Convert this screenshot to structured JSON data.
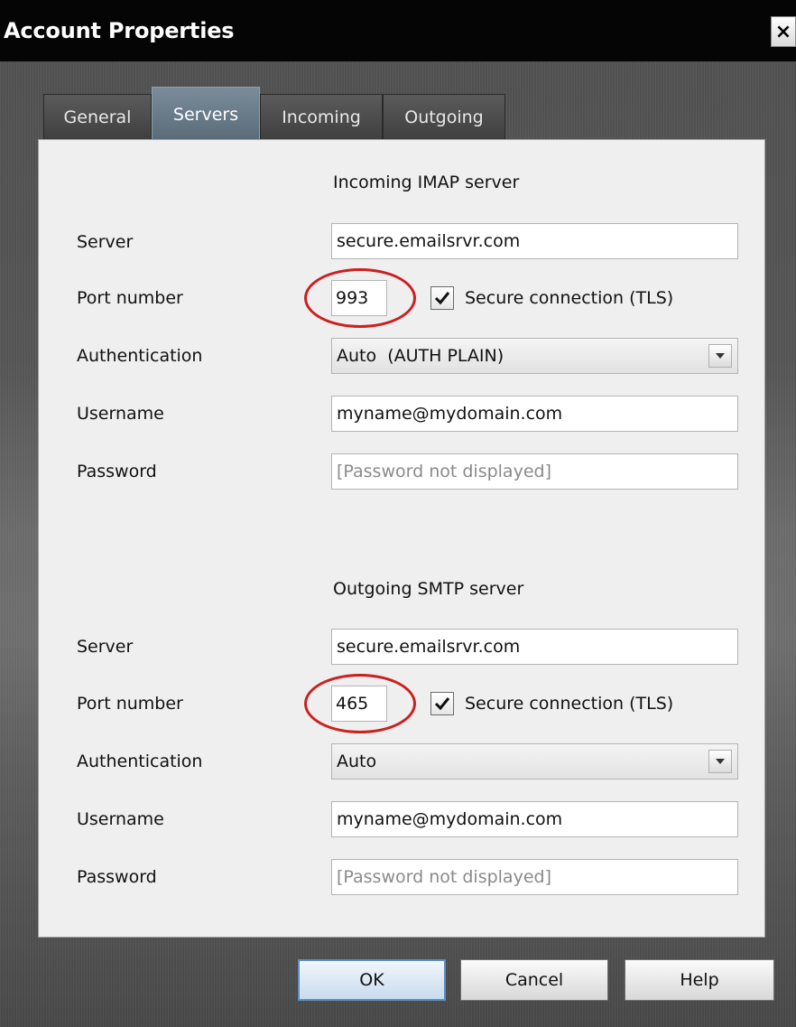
{
  "window": {
    "title": "Account Properties",
    "close_glyph": "×"
  },
  "tabs": [
    {
      "label": "General",
      "active": false
    },
    {
      "label": "Servers",
      "active": true
    },
    {
      "label": "Incoming",
      "active": false
    },
    {
      "label": "Outgoing",
      "active": false
    }
  ],
  "incoming": {
    "section_title": "Incoming IMAP server",
    "server_label": "Server",
    "server_value": "secure.emailsrvr.com",
    "port_label": "Port number",
    "port_value": "993",
    "secure_checked": true,
    "secure_label": "Secure connection (TLS)",
    "auth_label": "Authentication",
    "auth_value": "Auto  (AUTH PLAIN)",
    "username_label": "Username",
    "username_value": "myname@mydomain.com",
    "password_label": "Password",
    "password_placeholder": "[Password not displayed]"
  },
  "outgoing": {
    "section_title": "Outgoing SMTP server",
    "server_label": "Server",
    "server_value": "secure.emailsrvr.com",
    "port_label": "Port number",
    "port_value": "465",
    "secure_checked": true,
    "secure_label": "Secure connection (TLS)",
    "auth_label": "Authentication",
    "auth_value": "Auto",
    "username_label": "Username",
    "username_value": "myname@mydomain.com",
    "password_label": "Password",
    "password_placeholder": "[Password not displayed]"
  },
  "buttons": {
    "ok": "OK",
    "cancel": "Cancel",
    "help": "Help"
  },
  "colors": {
    "annotation_circle": "#cc1f1f",
    "active_tab": "#6a7b88",
    "default_button_border": "#5d8fc4"
  },
  "icons": {
    "close": "close-icon",
    "checkmark": "checkmark-icon",
    "dropdown": "chevron-down-icon"
  }
}
